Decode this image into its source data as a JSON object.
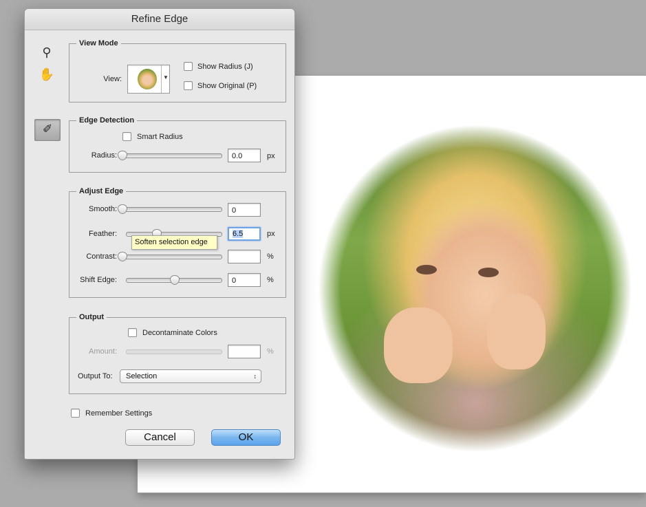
{
  "dialog": {
    "title": "Refine Edge",
    "view_mode": {
      "legend": "View Mode",
      "view_label": "View:",
      "show_radius": "Show Radius (J)",
      "show_original": "Show Original (P)"
    },
    "edge_detection": {
      "legend": "Edge Detection",
      "smart_radius": "Smart Radius",
      "radius_label": "Radius:",
      "radius_value": "0.0",
      "radius_unit": "px"
    },
    "adjust_edge": {
      "legend": "Adjust Edge",
      "smooth_label": "Smooth:",
      "smooth_value": "0",
      "feather_label": "Feather:",
      "feather_value": "6.5",
      "feather_unit": "px",
      "contrast_label": "Contrast:",
      "contrast_unit": "%",
      "shift_label": "Shift Edge:",
      "shift_value": "0",
      "shift_unit": "%",
      "tooltip": "Soften selection edge"
    },
    "output": {
      "legend": "Output",
      "decontaminate": "Decontaminate Colors",
      "amount_label": "Amount:",
      "amount_value": "",
      "amount_unit": "%",
      "output_to_label": "Output To:",
      "output_to_value": "Selection"
    },
    "remember_settings": "Remember Settings",
    "cancel_label": "Cancel",
    "ok_label": "OK"
  },
  "icons": [
    "zoom-icon",
    "hand-icon",
    "refine-radius-brush-icon",
    "dropdown-arrow-icon"
  ],
  "colors": {
    "ok_button": "#79b6ee",
    "tooltip_bg": "#ffffc5",
    "focus_ring": "#6fa3e6"
  }
}
